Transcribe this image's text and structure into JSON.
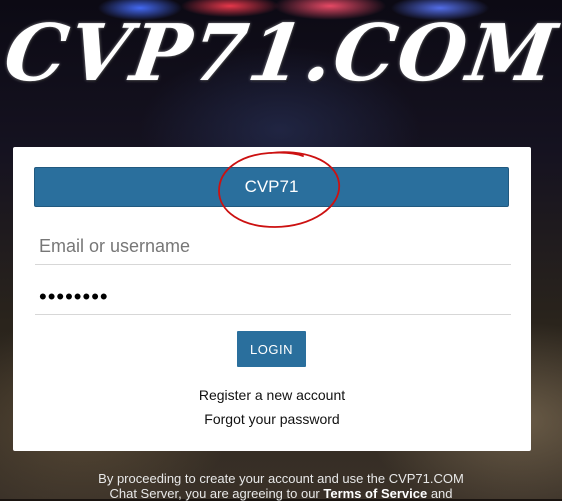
{
  "logo": {
    "text": "CVP71.COM"
  },
  "login": {
    "server_label": "CVP71",
    "email_placeholder": "Email or username",
    "password_value": "••••••••",
    "login_label": "LOGIN",
    "register_link": "Register a new account",
    "forgot_link": "Forgot your password"
  },
  "footer": {
    "line1": "By proceeding to create your account and use the CVP71.COM",
    "line2_prefix": "Chat Server, you are agreeing to our",
    "terms_link": "Terms of Service",
    "line2_suffix": "and"
  },
  "colors": {
    "accent": "#2a6f9d",
    "annotation_circle": "#cc1111"
  }
}
